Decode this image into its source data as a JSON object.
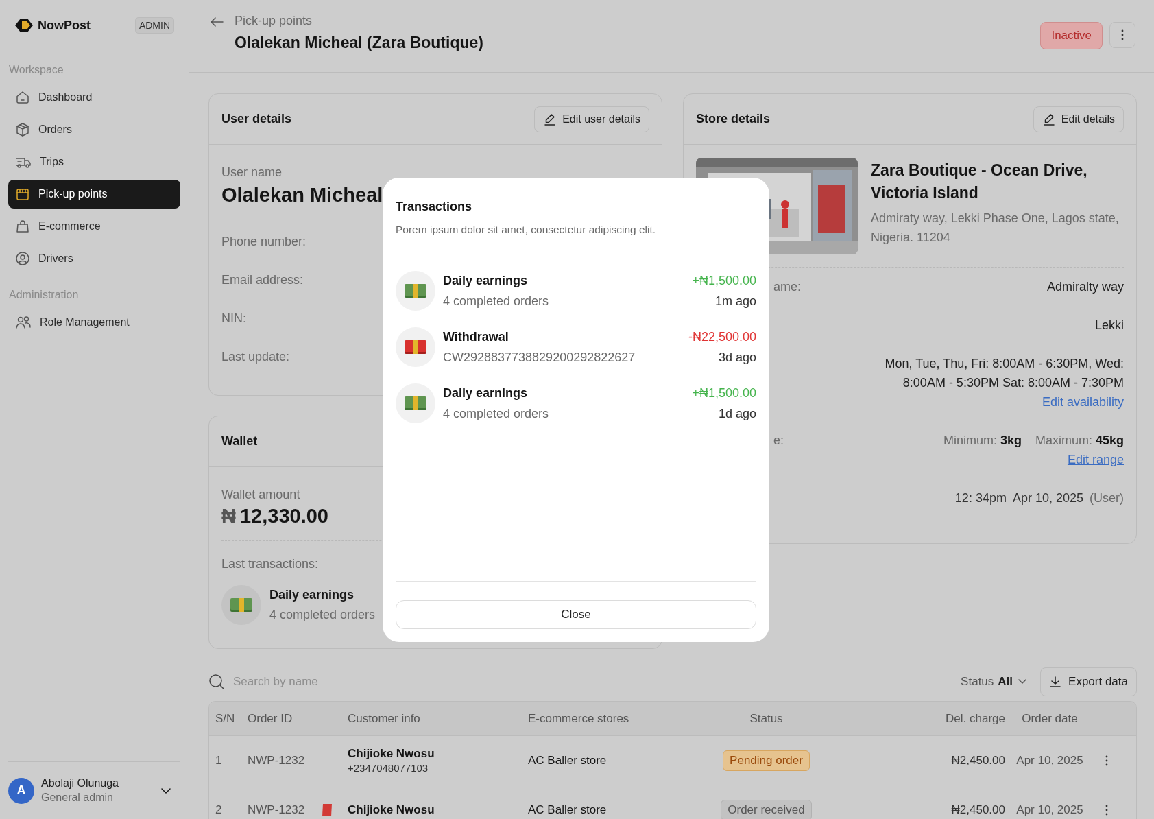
{
  "sidebar": {
    "brand": "NowPost",
    "badge": "ADMIN",
    "sections": [
      {
        "title": "Workspace",
        "items": [
          {
            "label": "Dashboard",
            "selected": false
          },
          {
            "label": "Orders",
            "selected": false
          },
          {
            "label": "Trips",
            "selected": false
          },
          {
            "label": "Pick-up points",
            "selected": true
          },
          {
            "label": "E-commerce",
            "selected": false
          },
          {
            "label": "Drivers",
            "selected": false
          }
        ]
      },
      {
        "title": "Administration",
        "items": [
          {
            "label": "Role Management",
            "selected": false
          }
        ]
      }
    ],
    "user": {
      "initial": "A",
      "name": "Abolaji Olunuga",
      "role": "General admin"
    }
  },
  "header": {
    "breadcrumb": "Pick-up points",
    "title": "Olalekan Micheal (Zara Boutique)",
    "status": "Inactive"
  },
  "user_details": {
    "title": "User details",
    "action": "Edit user details",
    "name_label": "User name",
    "name": "Olalekan Micheal",
    "fields": [
      "Phone number:",
      "Email address:",
      "NIN:",
      "Last update:"
    ]
  },
  "wallet": {
    "title": "Wallet",
    "amount_label": "Wallet amount",
    "currency": "₦",
    "amount": "12,330.00",
    "last_label": "Last transactions:",
    "last": {
      "kind": "credit",
      "title": "Daily earnings",
      "subtitle": "4 completed orders"
    }
  },
  "store": {
    "title": "Store details",
    "action": "Edit details",
    "name": "Zara Boutique - Ocean Drive, Victoria Island",
    "address": "Admiraty way, Lekki Phase One, Lagos state, Nigeria. 11204",
    "rows": [
      {
        "kind": "text",
        "label": "ame:",
        "lines": [
          "Admiralty way"
        ]
      },
      {
        "kind": "text",
        "lines": [
          "Lekki"
        ]
      },
      {
        "kind": "text",
        "lines": [
          "Mon, Tue, Thu, Fri: 8:00AM - 6:30PM, Wed:",
          "8:00AM - 5:30PM Sat: 8:00AM - 7:30PM"
        ],
        "link": "Edit availability"
      },
      {
        "kind": "range",
        "label": "e:",
        "values": [
          "Minimum: **3kg**",
          "Maximum: **45kg**"
        ],
        "link": "Edit range"
      },
      {
        "kind": "update",
        "values": [
          "12: 34pm",
          "Apr 10, 2025",
          "(User)"
        ]
      }
    ]
  },
  "orders": {
    "search": {
      "placeholder": "Search by name"
    },
    "filter": {
      "label": "Status",
      "value": "All"
    },
    "export": "Export data",
    "columns": [
      "S/N",
      "Order ID",
      "Customer info",
      "E-commerce stores",
      "Status",
      "Del. charge",
      "Order date"
    ],
    "rows": [
      {
        "sn": "1",
        "order_id": "NWP-1232",
        "flagged": false,
        "customer": "Chijioke Nwosu",
        "phone": "+2347048077103",
        "store": "AC Baller store",
        "status": {
          "label": "Pending order",
          "kind": "pending"
        },
        "charge": "₦2,450.00",
        "date": "Apr 10, 2025"
      },
      {
        "sn": "2",
        "order_id": "NWP-1232",
        "flagged": true,
        "customer": "Chijioke Nwosu",
        "store": "AC Baller store",
        "status": {
          "label": "Order received",
          "kind": "received"
        },
        "charge": "₦2,450.00",
        "date": "Apr 10, 2025"
      }
    ]
  },
  "modal": {
    "title": "Transactions",
    "subtitle": "Porem ipsum dolor sit amet, consectetur adipiscing elit.",
    "close": "Close",
    "items": [
      {
        "kind": "credit",
        "title": "Daily earnings",
        "subtitle": "4 completed orders",
        "amount": "+₦1,500.00",
        "time": "1m ago"
      },
      {
        "kind": "debit",
        "title": "Withdrawal",
        "subtitle": "CW2928837738829200292822627",
        "amount": "-₦22,500.00",
        "time": "3d ago"
      },
      {
        "kind": "credit",
        "title": "Daily earnings",
        "subtitle": "4 completed orders",
        "amount": "+₦1,500.00",
        "time": "1d ago"
      }
    ]
  }
}
